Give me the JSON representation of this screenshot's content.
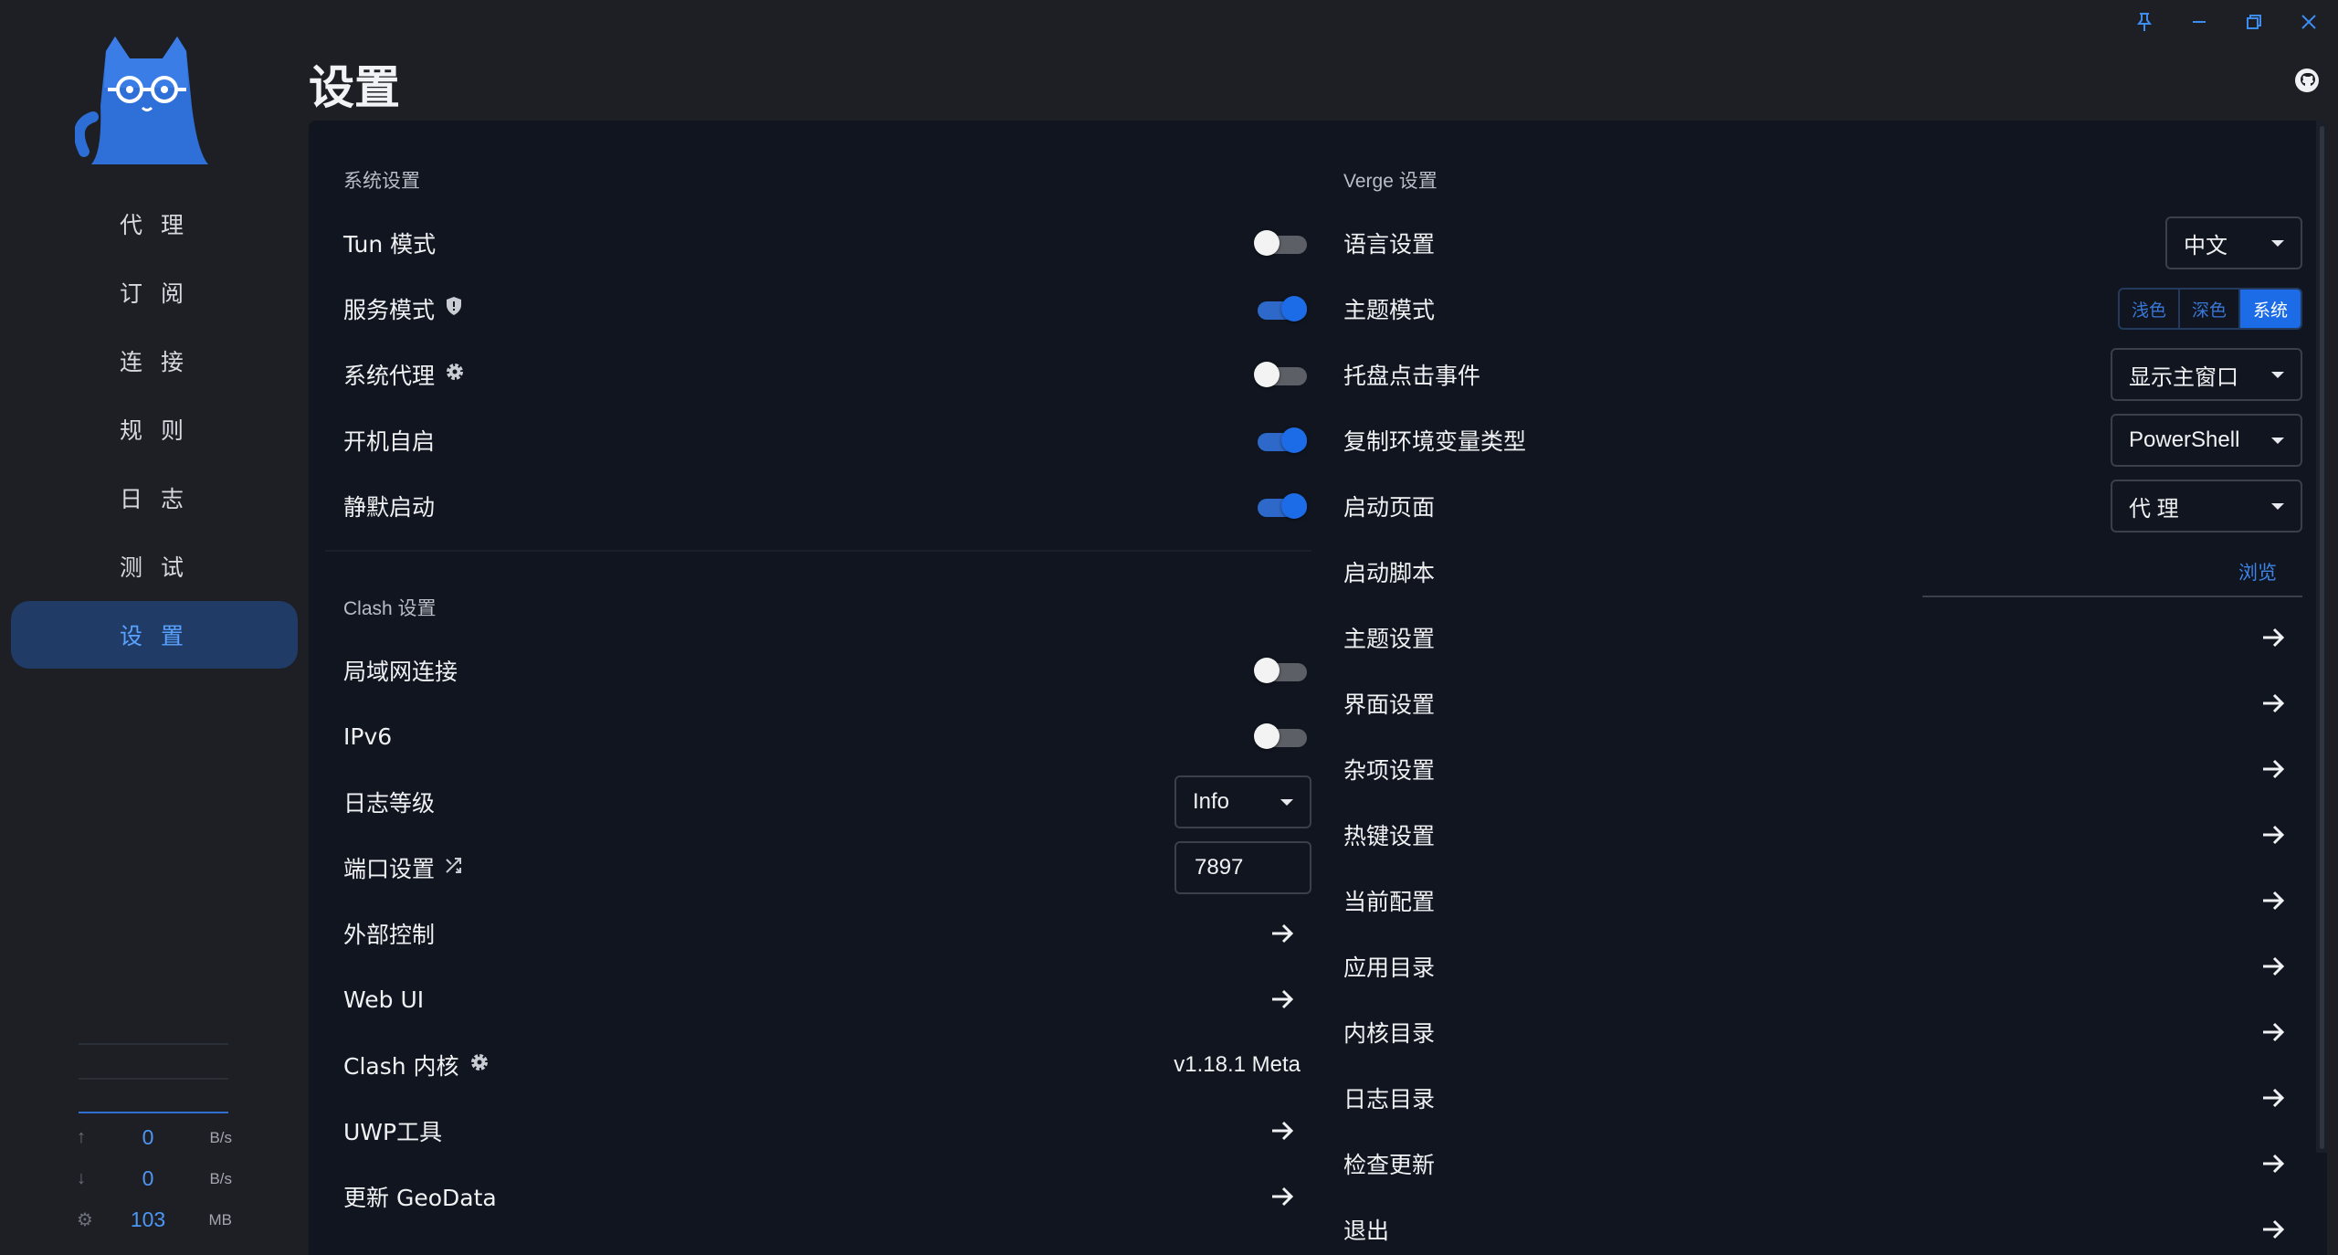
{
  "window": {
    "icons": [
      "pin-icon",
      "minimize-icon",
      "restore-icon",
      "close-icon"
    ]
  },
  "header": {
    "title": "设置"
  },
  "sidebar": {
    "items": [
      {
        "label": "代 理",
        "active": false
      },
      {
        "label": "订 阅",
        "active": false
      },
      {
        "label": "连 接",
        "active": false
      },
      {
        "label": "规 则",
        "active": false
      },
      {
        "label": "日 志",
        "active": false
      },
      {
        "label": "测 试",
        "active": false
      },
      {
        "label": "设 置",
        "active": true
      }
    ],
    "traffic": {
      "upload": {
        "value": "0",
        "unit": "B/s"
      },
      "download": {
        "value": "0",
        "unit": "B/s"
      },
      "memory": {
        "value": "103",
        "unit": "MB"
      }
    }
  },
  "system": {
    "title": "系统设置",
    "tun": {
      "label": "Tun 模式",
      "on": false
    },
    "service": {
      "label": "服务模式",
      "on": true
    },
    "proxy": {
      "label": "系统代理",
      "on": false
    },
    "autostart": {
      "label": "开机自启",
      "on": true
    },
    "silent": {
      "label": "静默启动",
      "on": true
    }
  },
  "clash": {
    "title": "Clash 设置",
    "lan": {
      "label": "局域网连接",
      "on": false
    },
    "ipv6": {
      "label": "IPv6",
      "on": false
    },
    "loglevel": {
      "label": "日志等级",
      "value": "Info"
    },
    "port": {
      "label": "端口设置",
      "value": "7897"
    },
    "external": {
      "label": "外部控制"
    },
    "webui": {
      "label": "Web UI"
    },
    "core": {
      "label": "Clash 内核",
      "version": "v1.18.1 Meta"
    },
    "uwp": {
      "label": "UWP工具"
    },
    "geodata": {
      "label": "更新 GeoData"
    }
  },
  "verge": {
    "title": "Verge 设置",
    "language": {
      "label": "语言设置",
      "value": "中文"
    },
    "theme_mode": {
      "label": "主题模式",
      "options": [
        "浅色",
        "深色",
        "系统"
      ],
      "selected": "系统"
    },
    "tray": {
      "label": "托盘点击事件",
      "value": "显示主窗口"
    },
    "copy_env": {
      "label": "复制环境变量类型",
      "value": "PowerShell"
    },
    "start_page": {
      "label": "启动页面",
      "value": "代 理"
    },
    "start_script": {
      "label": "启动脚本",
      "browse": "浏览"
    },
    "theme_setting": {
      "label": "主题设置"
    },
    "ui_setting": {
      "label": "界面设置"
    },
    "misc": {
      "label": "杂项设置"
    },
    "hotkey": {
      "label": "热键设置"
    },
    "current_config": {
      "label": "当前配置"
    },
    "app_dir": {
      "label": "应用目录"
    },
    "core_dir": {
      "label": "内核目录"
    },
    "log_dir": {
      "label": "日志目录"
    },
    "check_update": {
      "label": "检查更新"
    },
    "exit": {
      "label": "退出"
    }
  },
  "colors": {
    "accent": "#1b6ce6",
    "background": "#1e1f25",
    "panel": "#10151f"
  }
}
